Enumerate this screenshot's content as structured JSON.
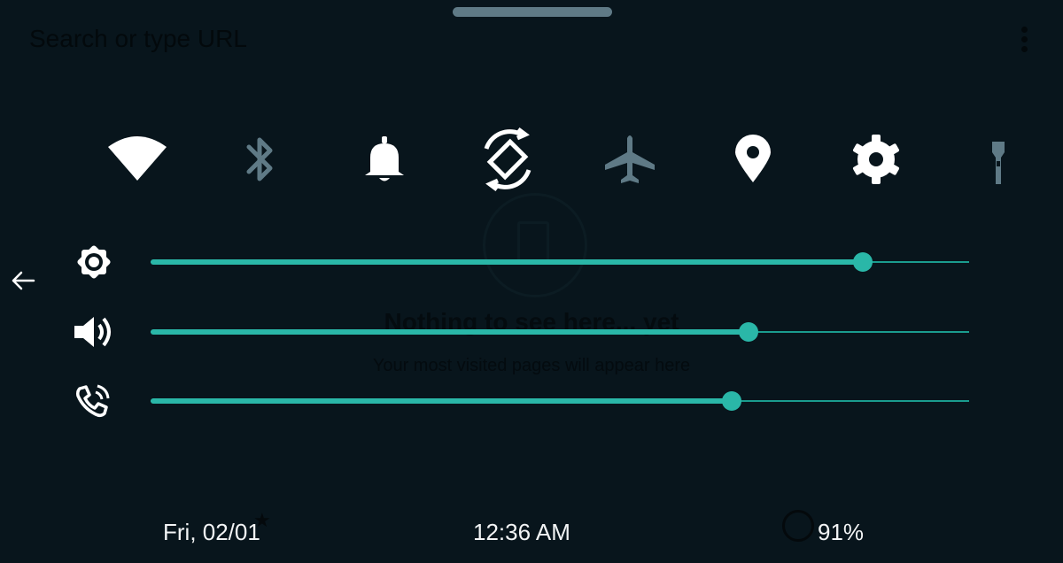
{
  "browser_background": {
    "search_placeholder": "Search or type URL",
    "empty_title": "Nothing to see here... yet",
    "empty_subtitle": "Your most visited pages will appear here"
  },
  "quick_settings": [
    {
      "name": "wifi",
      "icon": "wifi-icon",
      "active": true
    },
    {
      "name": "bluetooth",
      "icon": "bluetooth-icon",
      "active": false
    },
    {
      "name": "notifications",
      "icon": "bell-icon",
      "active": true
    },
    {
      "name": "auto-rotate",
      "icon": "rotate-icon",
      "active": true
    },
    {
      "name": "airplane-mode",
      "icon": "airplane-icon",
      "active": false
    },
    {
      "name": "location",
      "icon": "location-pin-icon",
      "active": true
    },
    {
      "name": "settings",
      "icon": "gear-icon",
      "active": true
    },
    {
      "name": "flashlight",
      "icon": "flashlight-icon",
      "active": false
    }
  ],
  "sliders": [
    {
      "name": "brightness",
      "icon": "brightness-icon",
      "level": 0.87
    },
    {
      "name": "media-volume",
      "icon": "volume-icon",
      "level": 0.73
    },
    {
      "name": "ringtone-volume",
      "icon": "ring-volume-icon",
      "level": 0.71
    }
  ],
  "footer": {
    "date": "Fri, 02/01",
    "time": "12:36 AM",
    "battery": "91%"
  },
  "colors": {
    "background": "#08151c",
    "accent": "#2ab7a8",
    "icon_active": "#ffffff",
    "icon_inactive": "#5f7a86"
  }
}
